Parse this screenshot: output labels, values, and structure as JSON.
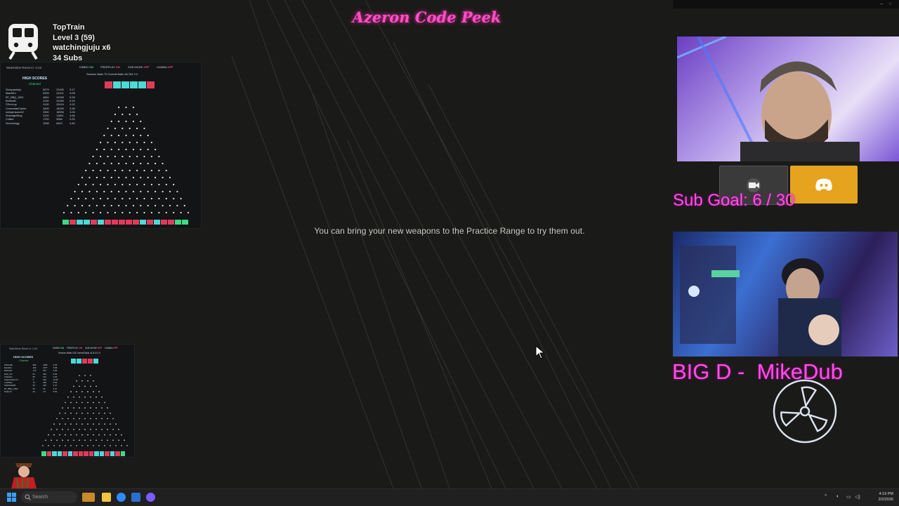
{
  "stream": {
    "title": "Azeron Code Peek",
    "message": "You can bring your new weapons to the Practice Range to try them out."
  },
  "train": {
    "icon": "train-icon",
    "line1": "TopTrain",
    "line2": "Level 3  (59)",
    "line3": "watchingjuju x6",
    "line4": "34 Subs"
  },
  "plinko_big": {
    "timer": "Watchtime Reset in: 2:43",
    "hs_title": "HIGH SCORES",
    "hs_sub": "Channel",
    "rows": [
      {
        "name": "Stanyrashaly",
        "a": "6279",
        "b": "22465",
        "c": "5.17"
      },
      {
        "name": "Marelf1n",
        "a": "6325",
        "b": "22101",
        "c": "5.08"
      },
      {
        "name": "RT_BBQ_1821",
        "a": "4661",
        "b": "24258",
        "c": "5.28"
      },
      {
        "name": "Britthsith",
        "a": "4130",
        "b": "31265",
        "c": "5.15"
      },
      {
        "name": "STemLoy",
        "a": "4130",
        "b": "20419",
        "c": "4.92"
      },
      {
        "name": "CemcelatoCanrie",
        "a": "3495",
        "b": "18159",
        "c": "5.38"
      },
      {
        "name": "rubiyamssoe42",
        "a": "3390",
        "b": "16596",
        "c": "3.06"
      },
      {
        "name": "Sharntgirtking",
        "a": "2120",
        "b": "11804",
        "c": "4.68"
      },
      {
        "name": "Collies",
        "a": "1700",
        "b": "9068",
        "c": "5.33"
      },
      {
        "name": "Scovbolagy",
        "a": "1538",
        "b": "8443",
        "c": "5.45"
      }
    ],
    "stats": [
      {
        "k": "KIMBO",
        "v": "ON"
      },
      {
        "k": "FREEPLAY",
        "v": "ON"
      },
      {
        "k": "SUB MODE",
        "v": "OFF"
      },
      {
        "k": "GAMBA",
        "v": "OFF"
      }
    ],
    "session": "Session Balls   75      Overall Balls   48,764    0    0"
  },
  "plinko_small": {
    "timer": "Watchtime Reset in: 1:40",
    "hs_title": "HIGH SCORES",
    "hs_sub": "Channel",
    "rows": [
      {
        "name": "IKKIGHE",
        "a": "982",
        "b": "1486",
        "c": "5.33"
      },
      {
        "name": "Marelf1n",
        "a": "203",
        "b": "1677",
        "c": "5.68"
      },
      {
        "name": "Britthsith",
        "a": "173",
        "b": "874",
        "c": "5.06"
      },
      {
        "name": "Dark_FS",
        "a": "81",
        "b": "491",
        "c": "6.06"
      },
      {
        "name": "ChalotFe",
        "a": "80",
        "b": "371",
        "c": "4.63"
      },
      {
        "name": "kappaclassin71",
        "a": "5",
        "b": "120",
        "c": "15.36"
      },
      {
        "name": "Lostbaby",
        "a": "73",
        "b": "436",
        "c": "5.59"
      },
      {
        "name": "FRHSCEOB",
        "a": "63",
        "b": "423",
        "c": "6.37"
      },
      {
        "name": "RT_BBQ_1821",
        "a": "53",
        "b": "43",
        "c": "3.27"
      },
      {
        "name": "Rafecoll",
        "a": "40",
        "b": "1.9",
        "c": "5.56"
      }
    ],
    "stats": [
      {
        "k": "KIMBO",
        "v": "ON"
      },
      {
        "k": "FREEPLAY",
        "v": "ON"
      },
      {
        "k": "SUB MODE",
        "v": "OFF"
      },
      {
        "k": "GAMBA",
        "v": "OFF"
      }
    ],
    "session": "Session Balls  104     Overall Balls  41,814   0    0"
  },
  "right": {
    "sub_goal": "Sub Goal: 6 / 30",
    "big_d": "BIG D -  MikeDub",
    "video_icon": "video-camera-icon",
    "discord_icon": "discord-icon",
    "radiation_icon": "radiation-icon"
  },
  "taskbar": {
    "search_placeholder": "Search",
    "time": "4:19 PM",
    "date": "2/2/2026"
  }
}
